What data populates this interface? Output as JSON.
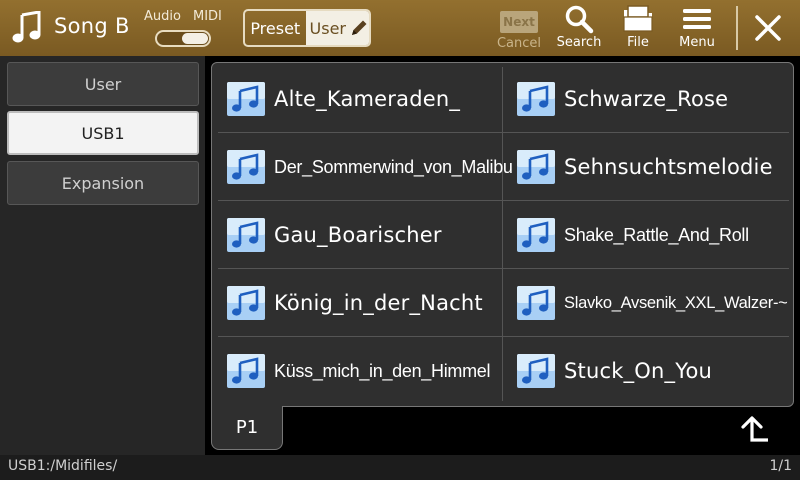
{
  "header": {
    "title": "Song B",
    "audio_label": "Audio",
    "midi_label": "MIDI",
    "preset_label": "Preset",
    "user_label": "User",
    "next_label": "Next",
    "cancel_label": "Cancel",
    "search_label": "Search",
    "file_label": "File",
    "menu_label": "Menu"
  },
  "sidebar": {
    "items": [
      {
        "label": "User",
        "active": false
      },
      {
        "label": "USB1",
        "active": true
      },
      {
        "label": "Expansion",
        "active": false
      }
    ]
  },
  "songs": [
    "Alte_Kameraden_",
    "Der_Sommerwind_von_Malibu",
    "Gau_Boarischer",
    "König_in_der_Nacht",
    "Küss_mich_in_den_Himmel",
    "Schwarze_Rose",
    "Sehnsuchtsmelodie",
    "Shake_Rattle_And_Roll",
    "Slavko_Avsenik_XXL_Walzer-~",
    "Stuck_On_You"
  ],
  "pager": {
    "tab_label": "P1"
  },
  "status": {
    "path": "USB1:/Midifiles/",
    "page": "1/1"
  },
  "colors": {
    "header": "#8a6a2c",
    "panel": "#2f2f2f",
    "icon_blue": "#1f5fc0"
  }
}
